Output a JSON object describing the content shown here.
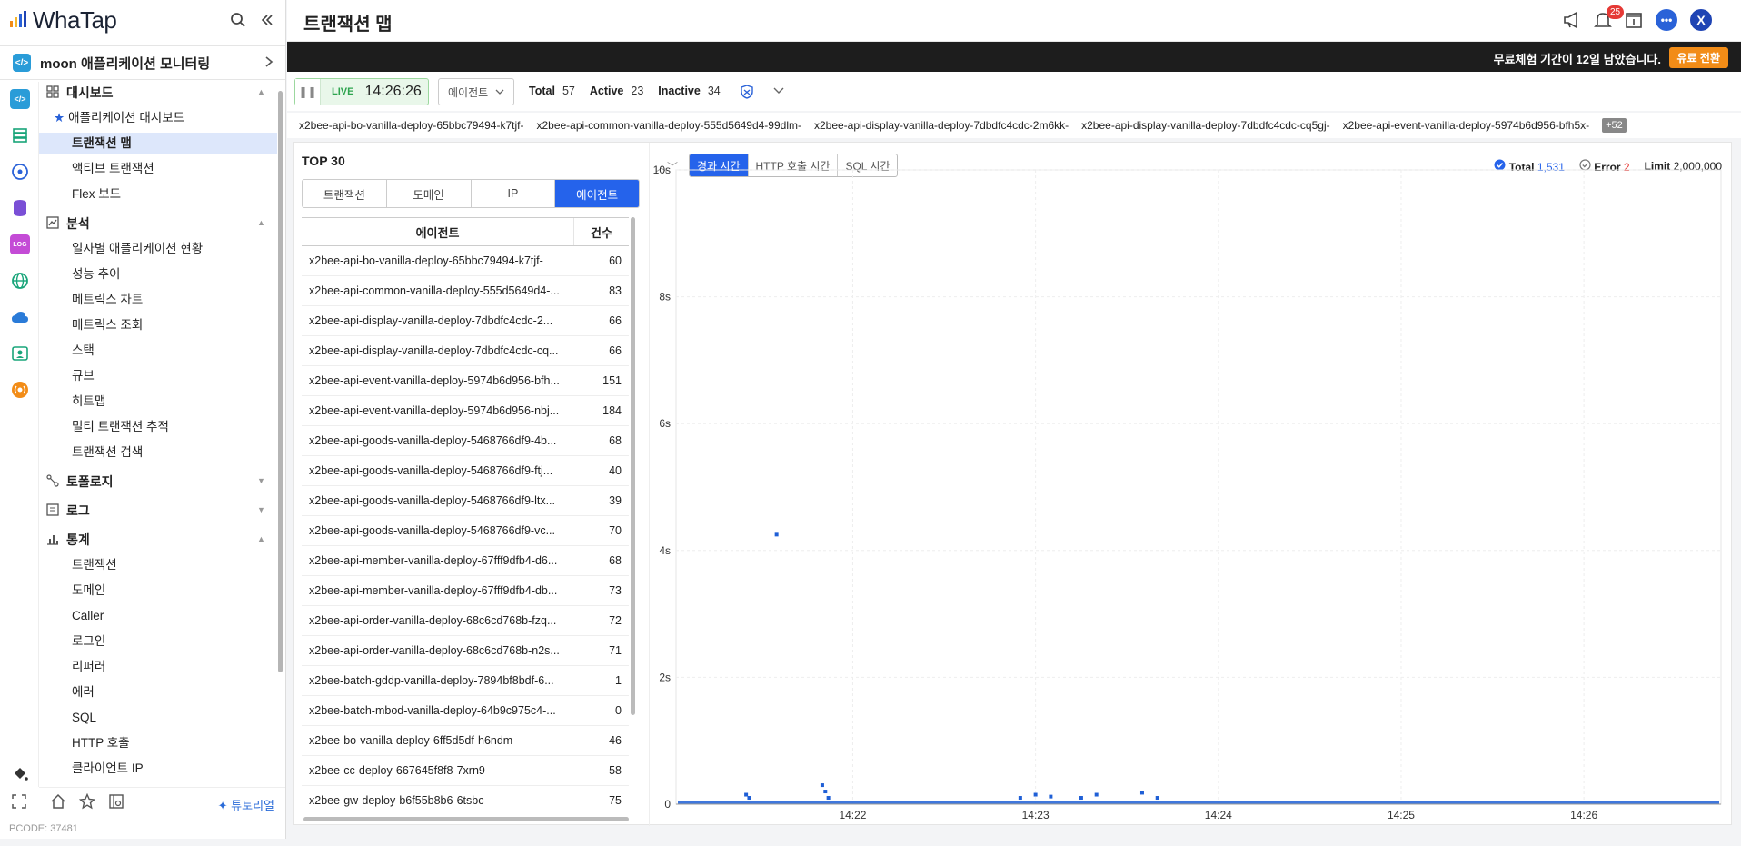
{
  "app": {
    "brand": "WhaTap",
    "pcode": "PCODE: 37481"
  },
  "project": {
    "name": "moon 애플리케이션 모니터링"
  },
  "header": {
    "title": "트랜잭션 맵",
    "notification_count": "25",
    "avatar_letter": "X"
  },
  "trial": {
    "text": "무료체험 기간이 12일 남았습니다.",
    "button": "유료 전환"
  },
  "sidebar": {
    "sections": [
      {
        "label": "대시보드",
        "icon": "dashboard-icon",
        "expanded": true,
        "items": [
          {
            "label": "애플리케이션 대시보드",
            "starred": true
          },
          {
            "label": "트랜잭션 맵",
            "active": true
          },
          {
            "label": "액티브 트랜잭션"
          },
          {
            "label": "Flex 보드"
          }
        ]
      },
      {
        "label": "분석",
        "icon": "analysis-icon",
        "expanded": true,
        "items": [
          {
            "label": "일자별 애플리케이션 현황"
          },
          {
            "label": "성능 추이"
          },
          {
            "label": "메트릭스 차트"
          },
          {
            "label": "메트릭스 조회"
          },
          {
            "label": "스택"
          },
          {
            "label": "큐브"
          },
          {
            "label": "히트맵"
          },
          {
            "label": "멀티 트랜잭션 추적"
          },
          {
            "label": "트랜잭션 검색"
          }
        ]
      },
      {
        "label": "토폴로지",
        "icon": "topology-icon",
        "expanded": false,
        "items": []
      },
      {
        "label": "로그",
        "icon": "log-icon",
        "expanded": false,
        "items": []
      },
      {
        "label": "통계",
        "icon": "stats-icon",
        "expanded": true,
        "items": [
          {
            "label": "트랜잭션"
          },
          {
            "label": "도메인"
          },
          {
            "label": "Caller"
          },
          {
            "label": "로그인"
          },
          {
            "label": "리퍼러"
          },
          {
            "label": "에러"
          },
          {
            "label": "SQL"
          },
          {
            "label": "HTTP 호출"
          },
          {
            "label": "클라이언트 IP"
          }
        ]
      }
    ],
    "tutorial": "튜토리얼"
  },
  "toolbar": {
    "live_label": "LIVE",
    "time": "14:26:26",
    "agent_dropdown": "에이전트",
    "total_label": "Total",
    "total": "57",
    "active_label": "Active",
    "active": "23",
    "inactive_label": "Inactive",
    "inactive": "34"
  },
  "agent_strip": {
    "agents": [
      "x2bee-api-bo-vanilla-deploy-65bbc79494-k7tjf-",
      "x2bee-api-common-vanilla-deploy-555d5649d4-99dlm-",
      "x2bee-api-display-vanilla-deploy-7dbdfc4cdc-2m6kk-",
      "x2bee-api-display-vanilla-deploy-7dbdfc4cdc-cq5gj-",
      "x2bee-api-event-vanilla-deploy-5974b6d956-bfh5x-"
    ],
    "more": "+52"
  },
  "top": {
    "title": "TOP 30",
    "tabs": [
      {
        "label": "트랜잭션"
      },
      {
        "label": "도메인"
      },
      {
        "label": "IP"
      },
      {
        "label": "에이전트",
        "active": true
      }
    ],
    "columns": [
      "에이전트",
      "건수"
    ],
    "rows": [
      [
        "x2bee-api-bo-vanilla-deploy-65bbc79494-k7tjf-",
        "60"
      ],
      [
        "x2bee-api-common-vanilla-deploy-555d5649d4-...",
        "83"
      ],
      [
        "x2bee-api-display-vanilla-deploy-7dbdfc4cdc-2...",
        "66"
      ],
      [
        "x2bee-api-display-vanilla-deploy-7dbdfc4cdc-cq...",
        "66"
      ],
      [
        "x2bee-api-event-vanilla-deploy-5974b6d956-bfh...",
        "151"
      ],
      [
        "x2bee-api-event-vanilla-deploy-5974b6d956-nbj...",
        "184"
      ],
      [
        "x2bee-api-goods-vanilla-deploy-5468766df9-4b...",
        "68"
      ],
      [
        "x2bee-api-goods-vanilla-deploy-5468766df9-ftj...",
        "40"
      ],
      [
        "x2bee-api-goods-vanilla-deploy-5468766df9-ltx...",
        "39"
      ],
      [
        "x2bee-api-goods-vanilla-deploy-5468766df9-vc...",
        "70"
      ],
      [
        "x2bee-api-member-vanilla-deploy-67fff9dfb4-d6...",
        "68"
      ],
      [
        "x2bee-api-member-vanilla-deploy-67fff9dfb4-db...",
        "73"
      ],
      [
        "x2bee-api-order-vanilla-deploy-68c6cd768b-fzq...",
        "72"
      ],
      [
        "x2bee-api-order-vanilla-deploy-68c6cd768b-n2s...",
        "71"
      ],
      [
        "x2bee-batch-gddp-vanilla-deploy-7894bf8bdf-6...",
        "1"
      ],
      [
        "x2bee-batch-mbod-vanilla-deploy-64b9c975c4-...",
        "0"
      ],
      [
        "x2bee-bo-vanilla-deploy-6ff5d5df-h6ndm-",
        "46"
      ],
      [
        "x2bee-cc-deploy-667645f8f8-7xrn9-",
        "58"
      ],
      [
        "x2bee-gw-deploy-b6f55b8b6-6tsbc-",
        "75"
      ]
    ]
  },
  "metric_tabs": [
    {
      "label": "경과 시간",
      "active": true
    },
    {
      "label": "HTTP 호출 시간"
    },
    {
      "label": "SQL 시간"
    }
  ],
  "legend": {
    "total_label": "Total",
    "total": "1,531",
    "error_label": "Error",
    "error": "2",
    "limit_label": "Limit",
    "limit": "2,000,000"
  },
  "chart_data": {
    "type": "scatter",
    "y_ticks": [
      "10s",
      "8s",
      "6s",
      "4s",
      "2s",
      "0"
    ],
    "ylim": [
      0,
      10
    ],
    "x_ticks": [
      "14:22",
      "14:23",
      "14:24",
      "14:25",
      "14:26"
    ],
    "grid": true,
    "colors": {
      "normal": "#1f5fd6",
      "error": "#e53935"
    },
    "points": [
      {
        "x": "14:21:35",
        "y": 4.25
      },
      {
        "x": "14:21:25",
        "y": 0.15
      },
      {
        "x": "14:21:26",
        "y": 0.1
      },
      {
        "x": "14:21:50",
        "y": 0.3
      },
      {
        "x": "14:21:51",
        "y": 0.2
      },
      {
        "x": "14:21:52",
        "y": 0.1
      },
      {
        "x": "14:22:55",
        "y": 0.1
      },
      {
        "x": "14:23:00",
        "y": 0.15
      },
      {
        "x": "14:23:05",
        "y": 0.12
      },
      {
        "x": "14:23:15",
        "y": 0.1
      },
      {
        "x": "14:23:20",
        "y": 0.15
      },
      {
        "x": "14:23:35",
        "y": 0.18
      },
      {
        "x": "14:23:40",
        "y": 0.1
      }
    ]
  }
}
